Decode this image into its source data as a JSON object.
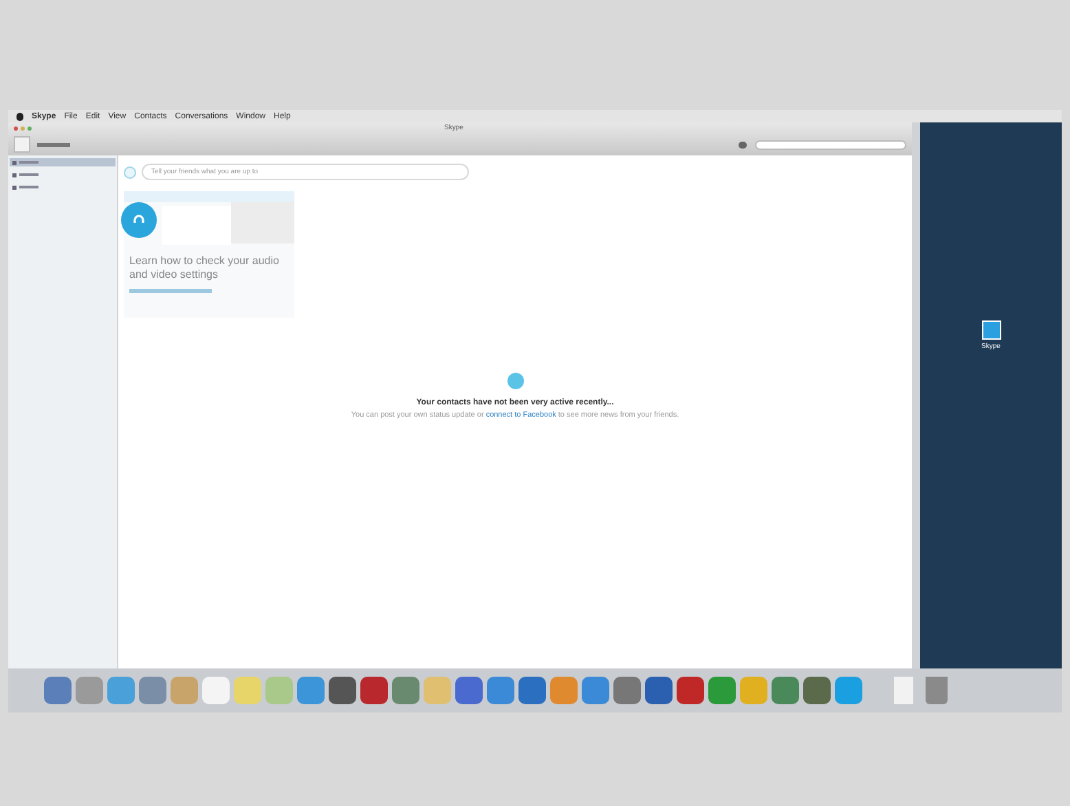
{
  "menu_bar": {
    "items": [
      "Skype",
      "File",
      "Edit",
      "View",
      "Contacts",
      "Conversations",
      "Window",
      "Help"
    ]
  },
  "window": {
    "title": "Skype"
  },
  "sidebar": {
    "items": [
      {
        "selected": true
      },
      {
        "selected": false
      },
      {
        "selected": false
      }
    ]
  },
  "mood_field": {
    "placeholder": "Tell your friends what you are up to"
  },
  "promo_card": {
    "text": "Learn how to check your audio and video settings"
  },
  "feed_empty": {
    "title": "Your contacts have not been very active recently...",
    "message_before": "You can post your own status update or ",
    "link": "connect to Facebook",
    "message_after": " to see more news from your friends."
  },
  "desktop_icon": {
    "label": "Skype"
  }
}
